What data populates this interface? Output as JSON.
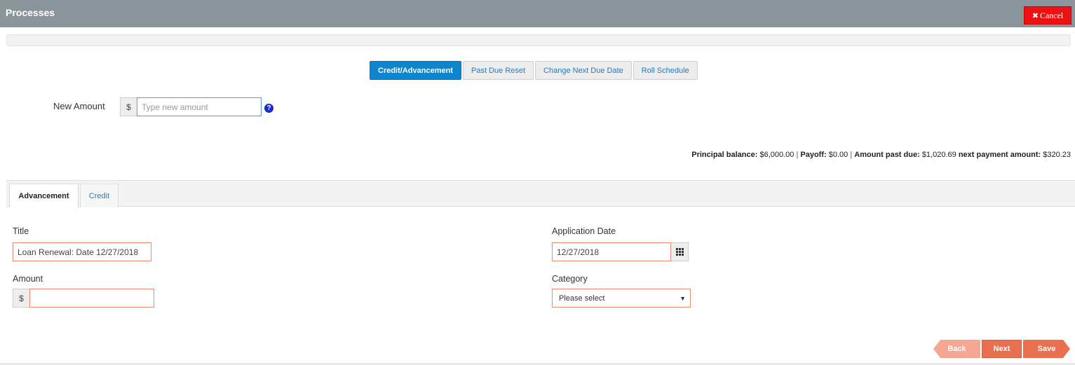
{
  "header": {
    "title": "Processes",
    "cancel_label": "Cancel"
  },
  "process_tabs": [
    {
      "label": "Credit/Advancement",
      "active": true
    },
    {
      "label": "Past Due Reset",
      "active": false
    },
    {
      "label": "Change Next Due Date",
      "active": false
    },
    {
      "label": "Roll Schedule",
      "active": false
    }
  ],
  "new_amount": {
    "label": "New Amount",
    "currency": "$",
    "placeholder": "Type new amount",
    "help": "?"
  },
  "summary": {
    "principal_label": "Principal balance:",
    "principal_value": "$6,000.00",
    "payoff_label": "Payoff:",
    "payoff_value": "$0.00",
    "past_due_label": "Amount past due:",
    "past_due_value": "$1,020.69",
    "next_payment_label": "next payment amount:",
    "next_payment_value": "$320.23",
    "separator": "|"
  },
  "form_tabs": [
    {
      "label": "Advancement",
      "active": true
    },
    {
      "label": "Credit",
      "active": false
    }
  ],
  "form": {
    "title_label": "Title",
    "title_value": "Loan Renewal: Date 12/27/2018",
    "amount_label": "Amount",
    "amount_currency": "$",
    "amount_value": "",
    "app_date_label": "Application Date",
    "app_date_value": "12/27/2018",
    "category_label": "Category",
    "category_selected": "Please select"
  },
  "wizard": {
    "back_label": "Back",
    "next_label": "Next",
    "save_label": "Save"
  },
  "colors": {
    "header": "#8a959b",
    "accent_blue": "#0d86cf",
    "cancel_red": "#ee1111",
    "wizard_orange": "#e8704f",
    "required_border": "#e98a6a"
  },
  "icons": {
    "cancel": "close-icon",
    "help": "question-circle-icon",
    "calendar": "calendar-grid-icon",
    "select": "caret-down-icon"
  }
}
